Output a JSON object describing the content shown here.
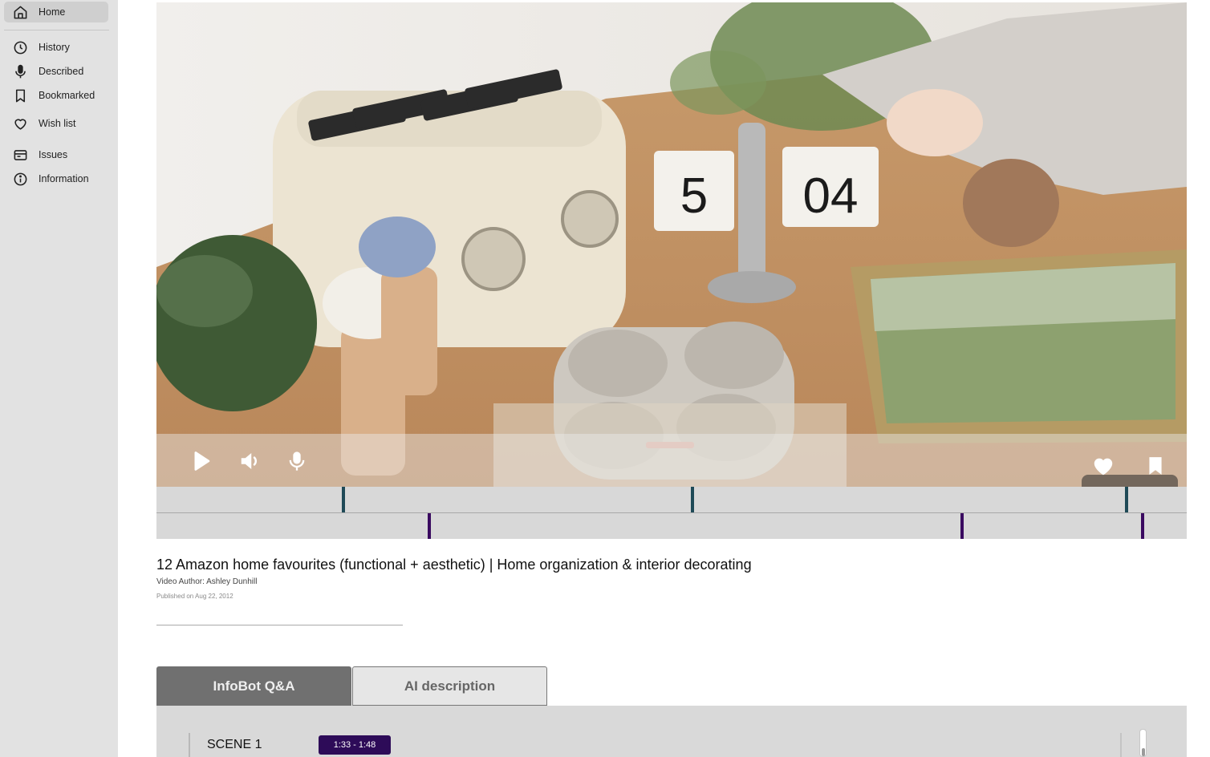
{
  "sidebar": {
    "items": [
      {
        "label": "Home",
        "icon": "home-icon",
        "active": true
      },
      {
        "label": "History",
        "icon": "clock-icon"
      },
      {
        "label": "Described",
        "icon": "microphone-icon"
      },
      {
        "label": "Bookmarked",
        "icon": "bookmark-icon"
      },
      {
        "label": "Wish list",
        "icon": "heart-icon"
      },
      {
        "label": "Issues",
        "icon": "card-icon"
      },
      {
        "label": "Information",
        "icon": "info-icon"
      }
    ]
  },
  "player": {
    "controls": [
      "play-icon",
      "volume-icon",
      "microphone-icon",
      "heart-icon",
      "bookmark-icon"
    ],
    "clock_digits_left": "5",
    "clock_digits_right": "04"
  },
  "video": {
    "title": "12 Amazon home favourites (functional + aesthetic) | Home organization & interior decorating",
    "author": "Video Author: Ashley Dunhill",
    "published": "Published on Aug 22, 2012"
  },
  "tabs": [
    {
      "label": "InfoBot Q&A",
      "active": true
    },
    {
      "label": "AI description",
      "active": false
    }
  ],
  "scenes": [
    {
      "label": "SCENE 1",
      "time": "1:33 - 1:48"
    }
  ],
  "colors": {
    "sidebar_bg": "#e2e2e2",
    "timeline_top_tick": "#1f4a57",
    "timeline_bottom_tick": "#3a0a60",
    "badge_bg": "#2d0b58",
    "tab_active_bg": "#707070"
  }
}
